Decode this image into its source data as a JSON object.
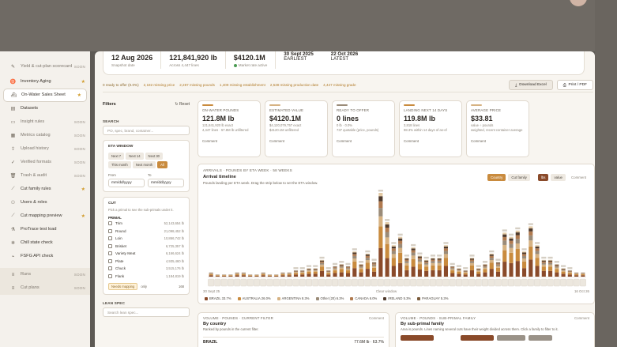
{
  "sidebar": {
    "items": [
      {
        "icon": "pen-icon",
        "label": "Yield & cut-plan scorecard",
        "tag": "SOON",
        "type": "tag"
      },
      {
        "icon": "cow-icon",
        "label": "Inventory Aging",
        "tag": "★",
        "type": "star"
      },
      {
        "icon": "ship-icon",
        "label": "On-Water Sales Sheet",
        "tag": "★",
        "type": "star",
        "active": true
      },
      {
        "icon": "table-icon",
        "label": "Datasets",
        "tag": "",
        "type": "none"
      },
      {
        "icon": "doc-icon",
        "label": "Insight rules",
        "tag": "SOON",
        "type": "tag"
      },
      {
        "icon": "grid-icon",
        "label": "Metrics catalog",
        "tag": "SOON",
        "type": "tag"
      },
      {
        "icon": "upload-icon",
        "label": "Upload history",
        "tag": "SOON",
        "type": "tag"
      },
      {
        "icon": "check-icon",
        "label": "Verified formats",
        "tag": "SOON",
        "type": "tag"
      },
      {
        "icon": "trash-icon",
        "label": "Trash & audit",
        "tag": "SOON",
        "type": "tag"
      },
      {
        "icon": "knife-icon",
        "label": "Cut family rules",
        "tag": "★",
        "type": "star"
      },
      {
        "icon": "users-icon",
        "label": "Users & roles",
        "tag": "",
        "type": "none"
      },
      {
        "icon": "knife-icon",
        "label": "Cut mapping preview",
        "tag": "★",
        "type": "star"
      },
      {
        "icon": "test-icon",
        "label": "ProTrace test load",
        "tag": "",
        "type": "none"
      },
      {
        "icon": "snow-icon",
        "label": "Chill state check",
        "tag": "",
        "type": "none"
      },
      {
        "icon": "api-icon",
        "label": "FSFG API check",
        "tag": "",
        "type": "none"
      },
      {
        "icon": "list-icon",
        "label": "Runs",
        "tag": "SOON",
        "type": "tag"
      },
      {
        "icon": "list-icon",
        "label": "Cut plans",
        "tag": "SOON",
        "type": "tag"
      }
    ],
    "lower": [
      {
        "icon": "list-icon",
        "label": "Runs",
        "tag": "SOON"
      },
      {
        "icon": "list-icon",
        "label": "Cut plans",
        "tag": "SOON"
      }
    ]
  },
  "summary": {
    "snapshot_value": "12 Aug 2026",
    "snapshot_label": "Snapshot date",
    "volume_value": "121,841,920 lb",
    "volume_label": "Across 4,447 lines",
    "value_value": "$4120.1M",
    "value_label": "Market rate active",
    "earliest_value": "30 Sept 2025",
    "earliest_label": "EARLIEST",
    "latest_value": "22 Oct 2026",
    "latest_label": "LATEST"
  },
  "readybar": {
    "ready": "0 ready to offer (0.0%)",
    "items": [
      "2,182 missing price",
      "2,287 missing pounds",
      "1,409 missing establishment",
      "2,538 missing production date",
      "4,447 missing grade"
    ],
    "download": "Download Excel",
    "print": "Print / PDF"
  },
  "filters": {
    "title": "Filters",
    "reset": "Reset",
    "search_label": "SEARCH",
    "search_placeholder": "PO, spec, brand, container...",
    "eta_title": "ETA WINDOW",
    "eta_chips": [
      "Next 7",
      "Next 14",
      "Next 30",
      "This month",
      "Next month",
      "All"
    ],
    "from_label": "From",
    "to_label": "To",
    "date_placeholder": "mm/dd/yyyy",
    "cut_title": "CUT",
    "cut_hint": "Pick a primal to see the sub-primals under it.",
    "primal_label": "PRIMAL",
    "cuts": [
      {
        "name": "Trim",
        "qty": "52,143,654 lb"
      },
      {
        "name": "Round",
        "qty": "21,098,452 lb"
      },
      {
        "name": "Loin",
        "qty": "10,866,742 lb"
      },
      {
        "name": "Brisket",
        "qty": "6,725,357 lb"
      },
      {
        "name": "Variety Meat",
        "qty": "6,166,624 lb"
      },
      {
        "name": "Plate",
        "qty": "4,935,460 lb"
      },
      {
        "name": "Chuck",
        "qty": "3,515,176 lb"
      },
      {
        "name": "Flank",
        "qty": "1,184,819 lb"
      }
    ],
    "needs_mapping": "Needs mapping",
    "only": "only",
    "needs_count": "168",
    "lean_spec": "LEAN SPEC",
    "lean_placeholder": "Search lean spec..."
  },
  "kpis": [
    {
      "key": "ON-WATER POUNDS",
      "value": "121.8M lb",
      "sub": "121,841,920 lb exact\n4,447 lines · 57.8M lb unfiltered",
      "comment": "Comment"
    },
    {
      "key": "ESTIMATED VALUE",
      "value": "$4120.1M",
      "sub": "$4,120,079,757 exact\n$4120.1M unfiltered",
      "comment": "Comment"
    },
    {
      "key": "READY TO OFFER",
      "value": "0 lines",
      "sub": "0 lb · 0.0%\n737 quotable (price, pounds)",
      "comment": "Comment"
    },
    {
      "key": "LANDING NEXT 14 DAYS",
      "value": "119.8M lb",
      "sub": "3,818 lines\n98.3% within 14 days of as-of",
      "comment": "Comment"
    },
    {
      "key": "AVERAGE PRICE",
      "value": "$33.81",
      "sub": "value ÷ pounds\nweighted, recent container average",
      "comment": "Comment"
    }
  ],
  "chart_panel": {
    "kicker": "ARRIVALS · POUNDS BY ETA WEEK · 58 WEEKS",
    "title": "Arrival timeline",
    "subtitle": "Pounds landing per ETA week. Drag the strip below to set the ETA window.",
    "seg1": [
      "Country",
      "Cut family"
    ],
    "seg2": [
      "lbs",
      "value"
    ],
    "comment": "Comment",
    "strip_left": "30 Sept 25",
    "strip_mid": "Clear window",
    "strip_right": "16 Oct 26"
  },
  "chart_data": {
    "type": "bar",
    "stacked": true,
    "series_colors": [
      "#8a4a2a",
      "#c98b3e",
      "#d6b282",
      "#9a8b78",
      "#b07a4f",
      "#4f3a2c",
      "#e2c9a4",
      "#7a5a3a"
    ],
    "weeks": 58,
    "totals": [
      2,
      1,
      1,
      1,
      2,
      2,
      1,
      1,
      2,
      1,
      1,
      2,
      2,
      3,
      3,
      4,
      4,
      8,
      3,
      5,
      6,
      5,
      12,
      6,
      11,
      7,
      40,
      26,
      15,
      19,
      9,
      14,
      10,
      8,
      9,
      9,
      15,
      5,
      4,
      3,
      9,
      4,
      6,
      11,
      7,
      21,
      19,
      22,
      12,
      24,
      15,
      8,
      8,
      6,
      4,
      3,
      2,
      2
    ]
  },
  "legend": [
    {
      "name": "BRAZIL 33.7%",
      "color": "#8a4a2a"
    },
    {
      "name": "AUSTRALIA 26.0%",
      "color": "#c98b3e"
    },
    {
      "name": "ARGENTINA 8.3%",
      "color": "#d6b282"
    },
    {
      "name": "Other (20) 6.3%",
      "color": "#9a8b78"
    },
    {
      "name": "CANADA 6.0%",
      "color": "#b07a4f"
    },
    {
      "name": "IRELAND 5.3%",
      "color": "#4f3a2c"
    },
    {
      "name": "PARAGUAY 5.3%",
      "color": "#7a5a3a"
    }
  ],
  "country_panel": {
    "kicker": "VOLUME · POUNDS · CURRENT FILTER",
    "title": "By country",
    "subtitle": "Ranked by pounds in the current filter.",
    "comment": "Comment",
    "row_name": "BRAZIL",
    "row_value": "77.6M lb · 63.7%"
  },
  "sub_panel": {
    "kicker": "VOLUME · POUNDS · SUB-PRIMAL FAMILY",
    "title": "By sub-primal family",
    "subtitle": "Area is pounds. Lines naming several cuts have their weight divided across them. Click a family to filter to it.",
    "comment": "Comment"
  }
}
